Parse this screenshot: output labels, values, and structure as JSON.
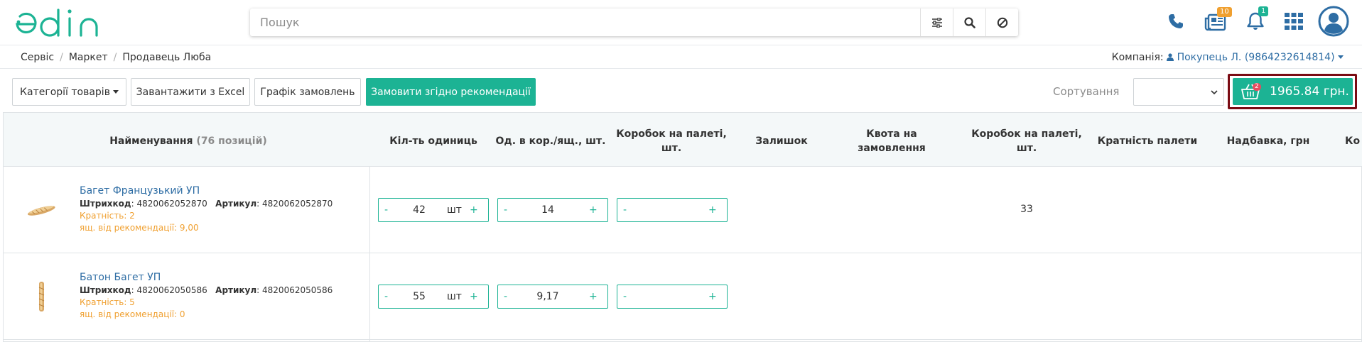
{
  "header": {
    "logo_text": "edin",
    "search_placeholder": "Пошук",
    "icons": [
      "filter-sliders-icon",
      "search-icon",
      "clear-icon",
      "phone-icon",
      "news-icon",
      "bell-icon",
      "apps-grid-icon",
      "user-avatar-icon"
    ],
    "news_badge": "10",
    "bell_badge": "1"
  },
  "breadcrumb": {
    "items": [
      "Сервіс",
      "Маркет",
      "Продавець Люба"
    ],
    "company_label": "Компанія:",
    "company_value": "Покупець Л. (9864232614814)"
  },
  "toolbar": {
    "categories": "Категорії товарів",
    "excel": "Завантажити з Excel",
    "schedule": "Графік замовлень",
    "recommend": "Замовити згідно рекомендації",
    "sort_label": "Сортування",
    "sort_value": "",
    "cart_badge": "2",
    "cart_total": "1965.84 грн."
  },
  "table": {
    "headers": {
      "name": "Найменування",
      "name_count": "(76 позицій)",
      "qty": "Кіл-ть одиниць",
      "per_box": "Од. в кор./ящ., шт.",
      "boxes_pallet_1a": "Коробок на палеті,",
      "boxes_pallet_1b": "шт.",
      "stock": "Залишок",
      "quota_a": "Квота на",
      "quota_b": "замовлення",
      "boxes_pallet_2a": "Коробок на палеті,",
      "boxes_pallet_2b": "шт.",
      "pallet_mult": "Кратність палети",
      "markup": "Надбавка, грн",
      "last": "Ко"
    },
    "rows": [
      {
        "name": "Багет Французький УП",
        "barcode_label": "Штрихкод",
        "barcode": ": 4820062052870",
        "article_label": "Артикул",
        "article": ": 4820062052870",
        "multiplicity": "Кратність:  2",
        "recommend": "ящ. від рекомендації:  9,00",
        "qty_minus": "-",
        "qty_value": "42",
        "qty_unit": "шт",
        "qty_plus": "+",
        "box_minus": "-",
        "box_value": "14",
        "box_plus": "+",
        "pal_minus": "-",
        "pal_value": "",
        "pal_plus": "+",
        "boxes_pallet": "33"
      },
      {
        "name": "Батон Багет УП",
        "barcode_label": "Штрихкод",
        "barcode": ": 4820062050586",
        "article_label": "Артикул",
        "article": ": 4820062050586",
        "multiplicity": "Кратність:  5",
        "recommend": "ящ. від рекомендації:  0",
        "qty_minus": "-",
        "qty_value": "55",
        "qty_unit": "шт",
        "qty_plus": "+",
        "box_minus": "-",
        "box_value": "9,17",
        "box_plus": "+",
        "pal_minus": "-",
        "pal_value": "",
        "pal_plus": "+",
        "boxes_pallet": ""
      }
    ]
  },
  "colors": {
    "accent": "#1cb394",
    "link": "#2e6da4",
    "highlight": "#7a0b13",
    "orange": "#f0a030"
  }
}
